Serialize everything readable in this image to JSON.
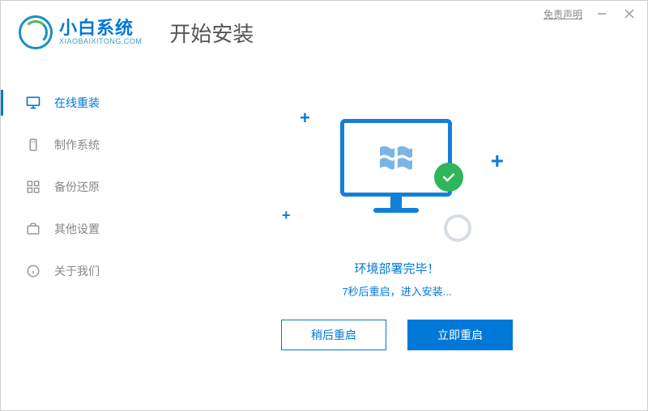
{
  "titlebar": {
    "disclaimer": "免责声明"
  },
  "header": {
    "logo_title": "小白系统",
    "logo_subtitle": "XIAOBAIXITONG.COM",
    "page_title": "开始安装"
  },
  "sidebar": {
    "items": [
      {
        "label": "在线重装",
        "active": true
      },
      {
        "label": "制作系统",
        "active": false
      },
      {
        "label": "备份还原",
        "active": false
      },
      {
        "label": "其他设置",
        "active": false
      },
      {
        "label": "关于我们",
        "active": false
      }
    ]
  },
  "main": {
    "status_title": "环境部署完毕！",
    "status_subtitle": "7秒后重启，进入安装...",
    "btn_later": "稍后重启",
    "btn_now": "立即重启"
  }
}
